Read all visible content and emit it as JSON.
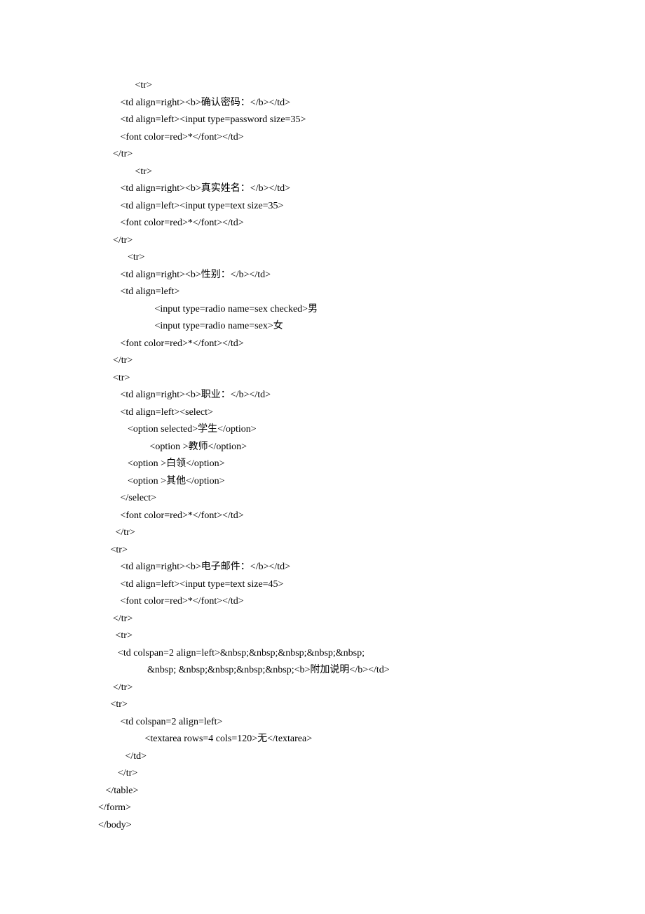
{
  "lines": [
    {
      "indent": 15,
      "text": "<tr>"
    },
    {
      "indent": 9,
      "text": "<td align=right><b>确认密码：</b></td>"
    },
    {
      "indent": 9,
      "text": "<td align=left><input type=password size=35>"
    },
    {
      "indent": 9,
      "text": "<font color=red>*</font></td>"
    },
    {
      "indent": 6,
      "text": "</tr>"
    },
    {
      "indent": 15,
      "text": "<tr>"
    },
    {
      "indent": 9,
      "text": "<td align=right><b>真实姓名：</b></td>"
    },
    {
      "indent": 9,
      "text": "<td align=left><input type=text size=35>"
    },
    {
      "indent": 9,
      "text": "<font color=red>*</font></td>"
    },
    {
      "indent": 6,
      "text": "</tr>"
    },
    {
      "indent": 12,
      "text": "<tr>"
    },
    {
      "indent": 9,
      "text": "<td align=right><b>性别：</b></td>"
    },
    {
      "indent": 9,
      "text": "<td align=left>"
    },
    {
      "indent": 23,
      "text": "<input type=radio name=sex checked>男"
    },
    {
      "indent": 23,
      "text": "<input type=radio name=sex>女"
    },
    {
      "indent": 9,
      "text": "<font color=red>*</font></td>"
    },
    {
      "indent": 6,
      "text": "</tr>"
    },
    {
      "indent": 6,
      "text": "<tr>"
    },
    {
      "indent": 9,
      "text": "<td align=right><b>职业：</b></td>"
    },
    {
      "indent": 9,
      "text": "<td align=left><select>"
    },
    {
      "indent": 12,
      "text": "<option selected>学生</option>"
    },
    {
      "indent": 21,
      "text": "<option >教师</option>"
    },
    {
      "indent": 12,
      "text": "<option >白领</option>"
    },
    {
      "indent": 12,
      "text": "<option >其他</option>"
    },
    {
      "indent": 9,
      "text": "</select>"
    },
    {
      "indent": 9,
      "text": "<font color=red>*</font></td>"
    },
    {
      "indent": 7,
      "text": "</tr>"
    },
    {
      "indent": 5,
      "text": "<tr>"
    },
    {
      "indent": 9,
      "text": "<td align=right><b>电子邮件：</b></td>"
    },
    {
      "indent": 9,
      "text": "<td align=left><input type=text size=45>"
    },
    {
      "indent": 9,
      "text": "<font color=red>*</font></td>"
    },
    {
      "indent": 6,
      "text": "</tr>"
    },
    {
      "indent": 7,
      "text": "<tr>"
    },
    {
      "indent": 8,
      "text": "<td colspan=2 align=left>&nbsp;&nbsp;&nbsp;&nbsp;&nbsp;"
    },
    {
      "indent": 20,
      "text": "&nbsp; &nbsp;&nbsp;&nbsp;&nbsp;<b>附加说明</b></td>"
    },
    {
      "indent": 6,
      "text": "</tr>"
    },
    {
      "indent": 5,
      "text": "<tr>"
    },
    {
      "indent": 9,
      "text": "<td colspan=2 align=left>"
    },
    {
      "indent": 19,
      "text": "<textarea rows=4 cols=120>无</textarea>"
    },
    {
      "indent": 11,
      "text": "</td>"
    },
    {
      "indent": 8,
      "text": "</tr>"
    },
    {
      "indent": 3,
      "text": "</table>"
    },
    {
      "indent": 0,
      "text": "</form>"
    },
    {
      "indent": 0,
      "text": "</body>"
    }
  ]
}
